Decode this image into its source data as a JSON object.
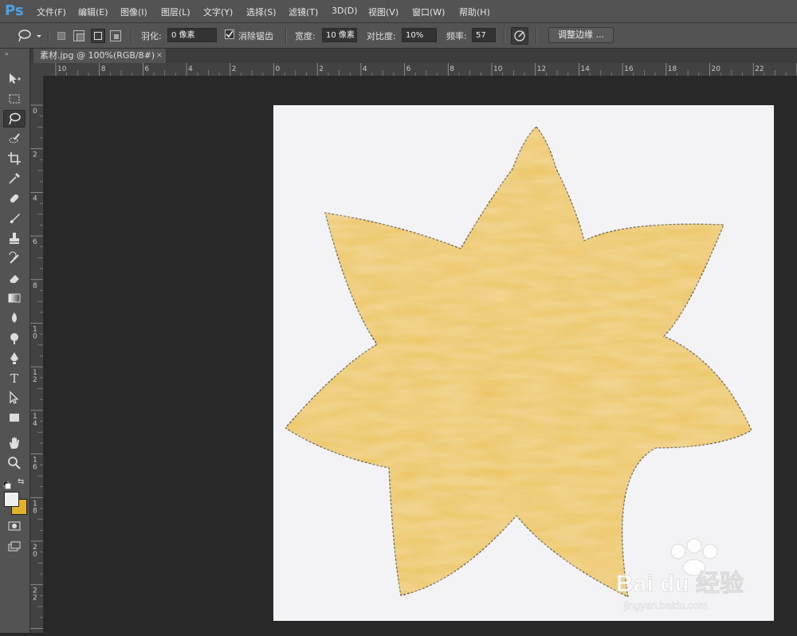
{
  "app": {
    "logo": "Ps"
  },
  "menu": {
    "items": [
      "文件(F)",
      "编辑(E)",
      "图像(I)",
      "图层(L)",
      "文字(Y)",
      "选择(S)",
      "滤镜(T)",
      "3D(D)",
      "视图(V)",
      "窗口(W)",
      "帮助(H)"
    ]
  },
  "options": {
    "feather_label": "羽化:",
    "feather_value": "0 像素",
    "antialias_label": "消除锯齿",
    "antialias_checked": true,
    "width_label": "宽度:",
    "width_value": "10 像素",
    "contrast_label": "对比度:",
    "contrast_value": "10%",
    "frequency_label": "频率:",
    "frequency_value": "57",
    "refine_edge_label": "调整边缘 ..."
  },
  "document": {
    "tab_title": "素材.jpg @ 100%(RGB/8#)",
    "close_glyph": "×"
  },
  "ruler": {
    "h_labels": [
      "10",
      "8",
      "6",
      "4",
      "2",
      "0",
      "2",
      "4",
      "6",
      "8",
      "10",
      "12",
      "14",
      "16",
      "18",
      "20",
      "22"
    ],
    "v_labels": [
      "0",
      "2",
      "4",
      "6",
      "8",
      "10",
      "12",
      "14",
      "16",
      "18",
      "20",
      "22"
    ]
  },
  "colors": {
    "ui_panel": "#535353",
    "workspace": "#282828",
    "canvas_bg": "#f3f2f4",
    "flower": "#ecc55d",
    "foreground": "#f0f0f0",
    "background": "#e3b12b"
  },
  "watermark": {
    "brand": "Bai du 经验",
    "url": "jingyan.baidu.com"
  }
}
